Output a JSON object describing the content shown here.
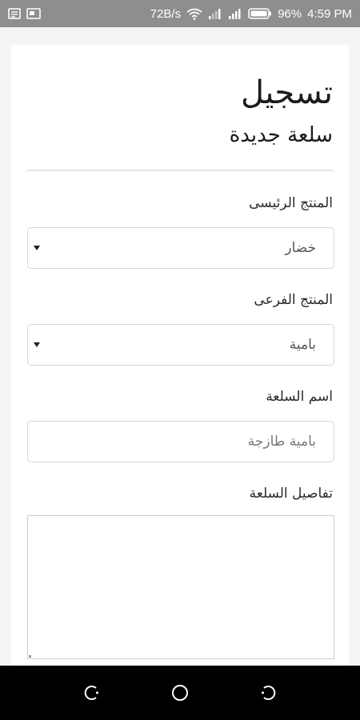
{
  "status_bar": {
    "speed": "72B/s",
    "battery_percent": "96%",
    "time": "4:59 PM",
    "icons": [
      "notes-icon",
      "gallery-icon",
      "wifi-icon",
      "signal-icon",
      "signal-icon",
      "battery-icon"
    ]
  },
  "form": {
    "title": "تسجيل",
    "subtitle": "سلعة جديدة",
    "main_product": {
      "label": "المنتج الرئيسى",
      "value": "خضار"
    },
    "sub_product": {
      "label": "المنتج الفرعى",
      "value": "بامية"
    },
    "item_name": {
      "label": "اسم السلعة",
      "placeholder": "بامية طازجة"
    },
    "item_details": {
      "label": "تفاصيل السلعة",
      "value": ""
    }
  },
  "nav_bar": {
    "icons": [
      "recents-icon",
      "home-icon",
      "back-icon"
    ]
  }
}
